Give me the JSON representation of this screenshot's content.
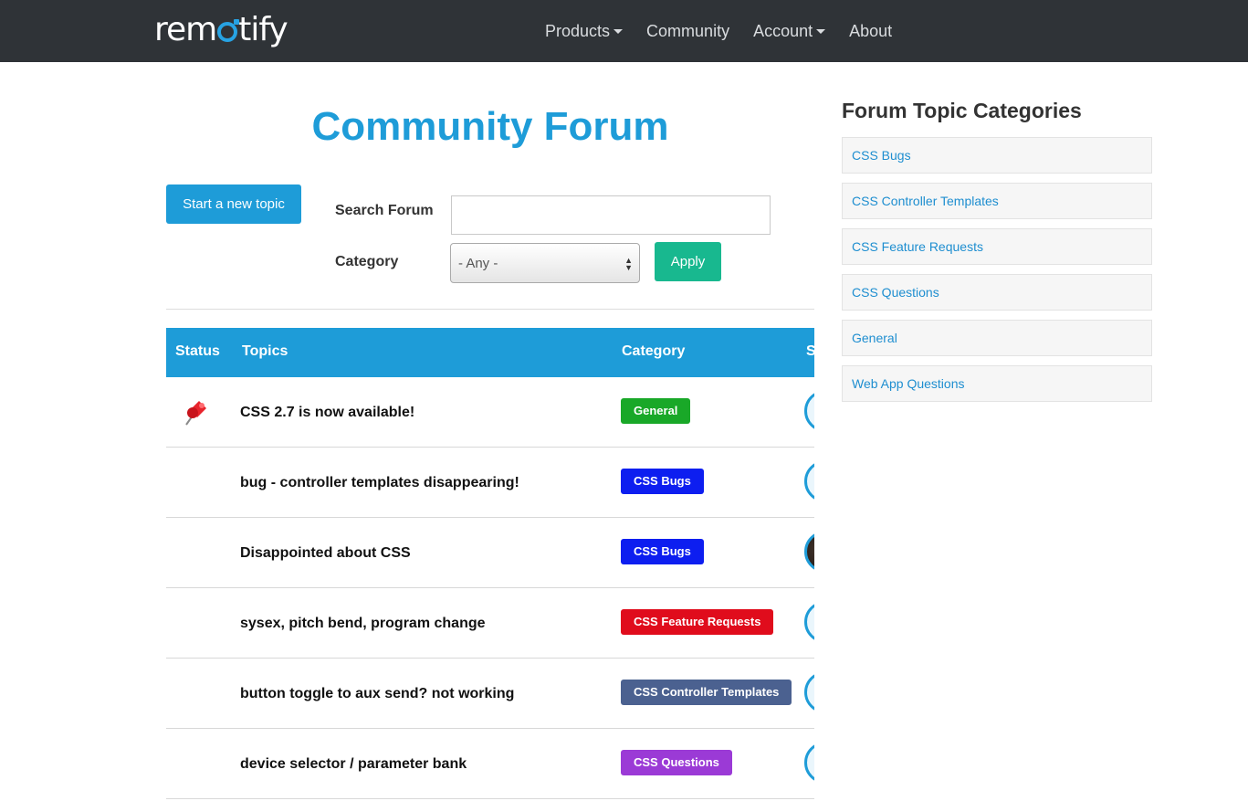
{
  "brand": {
    "logo_pre": "rem",
    "logo_post": "tify"
  },
  "nav": [
    {
      "label": "Products",
      "dropdown": true
    },
    {
      "label": "Community",
      "dropdown": false
    },
    {
      "label": "Account",
      "dropdown": true
    },
    {
      "label": "About",
      "dropdown": false
    }
  ],
  "main": {
    "title": "Community Forum",
    "new_topic_label": "Start a new topic",
    "search_label": "Search Forum",
    "search_value": "",
    "category_label": "Category",
    "category_selected": "- Any -",
    "apply_label": "Apply"
  },
  "table": {
    "headers": {
      "status": "Status",
      "topics": "Topics",
      "category": "Category",
      "fourth": "S"
    },
    "rows": [
      {
        "topic": "CSS 2.7 is now available!",
        "category": "General",
        "badge_color": "#19a828",
        "pinned": true,
        "avatar": "default"
      },
      {
        "topic": "bug - controller templates disappearing!",
        "category": "CSS Bugs",
        "badge_color": "#0d1ef0",
        "pinned": false,
        "avatar": "default"
      },
      {
        "topic": "Disappointed about CSS",
        "category": "CSS Bugs",
        "badge_color": "#0d1ef0",
        "pinned": false,
        "avatar": "photo"
      },
      {
        "topic": "sysex, pitch bend, program change",
        "category": "CSS Feature Requests",
        "badge_color": "#e00c1c",
        "pinned": false,
        "avatar": "default"
      },
      {
        "topic": "button toggle to aux send? not working",
        "category": "CSS Controller Templates",
        "badge_color": "#4b6190",
        "pinned": false,
        "avatar": "default"
      },
      {
        "topic": "device selector / parameter bank",
        "category": "CSS Questions",
        "badge_color": "#9b3ad6",
        "pinned": false,
        "avatar": "default"
      }
    ]
  },
  "sidebar": {
    "title": "Forum Topic Categories",
    "items": [
      "CSS Bugs",
      "CSS Controller Templates",
      "CSS Feature Requests",
      "CSS Questions",
      "General",
      "Web App Questions"
    ]
  },
  "colors": {
    "navbar": "#2f3337",
    "accent": "#1e9cd8",
    "apply": "#18b88f"
  },
  "icons": {
    "pin": "pushpin-icon",
    "dropdown": "caret-down-icon"
  }
}
